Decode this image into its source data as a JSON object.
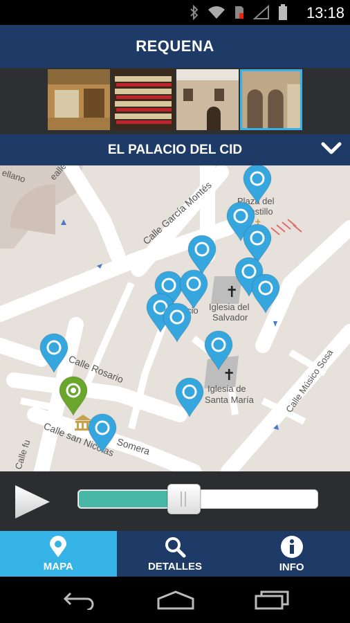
{
  "status_bar": {
    "time": "13:18"
  },
  "header": {
    "title": "REQUENA"
  },
  "gallery": {
    "selected_index": 3,
    "thumbnails": [
      "museum-interior",
      "wine-bottles",
      "stone-facade",
      "stone-arches"
    ]
  },
  "place": {
    "title": "EL PALACIO DEL CID"
  },
  "map": {
    "streets": {
      "s1": "Calle García Montés",
      "s2": "Calle Rosario",
      "s3": "Calle san Nicolas",
      "s4": "Somera",
      "s5": "Calle Músico Sosa",
      "s6": "ellano",
      "s7": "Calle fu",
      "s8": "ealle"
    },
    "landmarks": {
      "l1a": "Plaza del",
      "l1b": "Castillo",
      "l2a": "Iglesia del",
      "l2b": "Salvador",
      "l3a": "Iglesia de",
      "l3b": "Santa María",
      "l4": "Palacio"
    }
  },
  "player": {
    "progress": 0.44
  },
  "tabs": [
    {
      "label": "MAPA",
      "icon": "map-pin-icon"
    },
    {
      "label": "DETALLES",
      "icon": "search-icon"
    },
    {
      "label": "INFO",
      "icon": "info-icon"
    }
  ],
  "colors": {
    "header": "#1e3a66",
    "accent": "#36b3e6",
    "pin_blue": "#36a6df",
    "pin_green": "#6aa52c",
    "slider_fill": "#49b7a6"
  }
}
